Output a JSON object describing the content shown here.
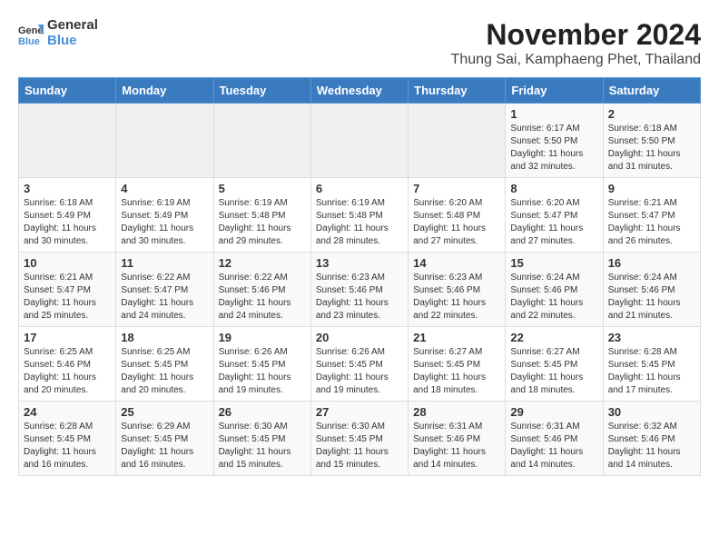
{
  "logo": {
    "general": "General",
    "blue": "Blue"
  },
  "header": {
    "month": "November 2024",
    "location": "Thung Sai, Kamphaeng Phet, Thailand"
  },
  "weekdays": [
    "Sunday",
    "Monday",
    "Tuesday",
    "Wednesday",
    "Thursday",
    "Friday",
    "Saturday"
  ],
  "weeks": [
    {
      "days": [
        {
          "num": "",
          "info": ""
        },
        {
          "num": "",
          "info": ""
        },
        {
          "num": "",
          "info": ""
        },
        {
          "num": "",
          "info": ""
        },
        {
          "num": "",
          "info": ""
        },
        {
          "num": "1",
          "info": "Sunrise: 6:17 AM\nSunset: 5:50 PM\nDaylight: 11 hours and 32 minutes."
        },
        {
          "num": "2",
          "info": "Sunrise: 6:18 AM\nSunset: 5:50 PM\nDaylight: 11 hours and 31 minutes."
        }
      ]
    },
    {
      "days": [
        {
          "num": "3",
          "info": "Sunrise: 6:18 AM\nSunset: 5:49 PM\nDaylight: 11 hours and 30 minutes."
        },
        {
          "num": "4",
          "info": "Sunrise: 6:19 AM\nSunset: 5:49 PM\nDaylight: 11 hours and 30 minutes."
        },
        {
          "num": "5",
          "info": "Sunrise: 6:19 AM\nSunset: 5:48 PM\nDaylight: 11 hours and 29 minutes."
        },
        {
          "num": "6",
          "info": "Sunrise: 6:19 AM\nSunset: 5:48 PM\nDaylight: 11 hours and 28 minutes."
        },
        {
          "num": "7",
          "info": "Sunrise: 6:20 AM\nSunset: 5:48 PM\nDaylight: 11 hours and 27 minutes."
        },
        {
          "num": "8",
          "info": "Sunrise: 6:20 AM\nSunset: 5:47 PM\nDaylight: 11 hours and 27 minutes."
        },
        {
          "num": "9",
          "info": "Sunrise: 6:21 AM\nSunset: 5:47 PM\nDaylight: 11 hours and 26 minutes."
        }
      ]
    },
    {
      "days": [
        {
          "num": "10",
          "info": "Sunrise: 6:21 AM\nSunset: 5:47 PM\nDaylight: 11 hours and 25 minutes."
        },
        {
          "num": "11",
          "info": "Sunrise: 6:22 AM\nSunset: 5:47 PM\nDaylight: 11 hours and 24 minutes."
        },
        {
          "num": "12",
          "info": "Sunrise: 6:22 AM\nSunset: 5:46 PM\nDaylight: 11 hours and 24 minutes."
        },
        {
          "num": "13",
          "info": "Sunrise: 6:23 AM\nSunset: 5:46 PM\nDaylight: 11 hours and 23 minutes."
        },
        {
          "num": "14",
          "info": "Sunrise: 6:23 AM\nSunset: 5:46 PM\nDaylight: 11 hours and 22 minutes."
        },
        {
          "num": "15",
          "info": "Sunrise: 6:24 AM\nSunset: 5:46 PM\nDaylight: 11 hours and 22 minutes."
        },
        {
          "num": "16",
          "info": "Sunrise: 6:24 AM\nSunset: 5:46 PM\nDaylight: 11 hours and 21 minutes."
        }
      ]
    },
    {
      "days": [
        {
          "num": "17",
          "info": "Sunrise: 6:25 AM\nSunset: 5:46 PM\nDaylight: 11 hours and 20 minutes."
        },
        {
          "num": "18",
          "info": "Sunrise: 6:25 AM\nSunset: 5:45 PM\nDaylight: 11 hours and 20 minutes."
        },
        {
          "num": "19",
          "info": "Sunrise: 6:26 AM\nSunset: 5:45 PM\nDaylight: 11 hours and 19 minutes."
        },
        {
          "num": "20",
          "info": "Sunrise: 6:26 AM\nSunset: 5:45 PM\nDaylight: 11 hours and 19 minutes."
        },
        {
          "num": "21",
          "info": "Sunrise: 6:27 AM\nSunset: 5:45 PM\nDaylight: 11 hours and 18 minutes."
        },
        {
          "num": "22",
          "info": "Sunrise: 6:27 AM\nSunset: 5:45 PM\nDaylight: 11 hours and 18 minutes."
        },
        {
          "num": "23",
          "info": "Sunrise: 6:28 AM\nSunset: 5:45 PM\nDaylight: 11 hours and 17 minutes."
        }
      ]
    },
    {
      "days": [
        {
          "num": "24",
          "info": "Sunrise: 6:28 AM\nSunset: 5:45 PM\nDaylight: 11 hours and 16 minutes."
        },
        {
          "num": "25",
          "info": "Sunrise: 6:29 AM\nSunset: 5:45 PM\nDaylight: 11 hours and 16 minutes."
        },
        {
          "num": "26",
          "info": "Sunrise: 6:30 AM\nSunset: 5:45 PM\nDaylight: 11 hours and 15 minutes."
        },
        {
          "num": "27",
          "info": "Sunrise: 6:30 AM\nSunset: 5:45 PM\nDaylight: 11 hours and 15 minutes."
        },
        {
          "num": "28",
          "info": "Sunrise: 6:31 AM\nSunset: 5:46 PM\nDaylight: 11 hours and 14 minutes."
        },
        {
          "num": "29",
          "info": "Sunrise: 6:31 AM\nSunset: 5:46 PM\nDaylight: 11 hours and 14 minutes."
        },
        {
          "num": "30",
          "info": "Sunrise: 6:32 AM\nSunset: 5:46 PM\nDaylight: 11 hours and 14 minutes."
        }
      ]
    }
  ]
}
